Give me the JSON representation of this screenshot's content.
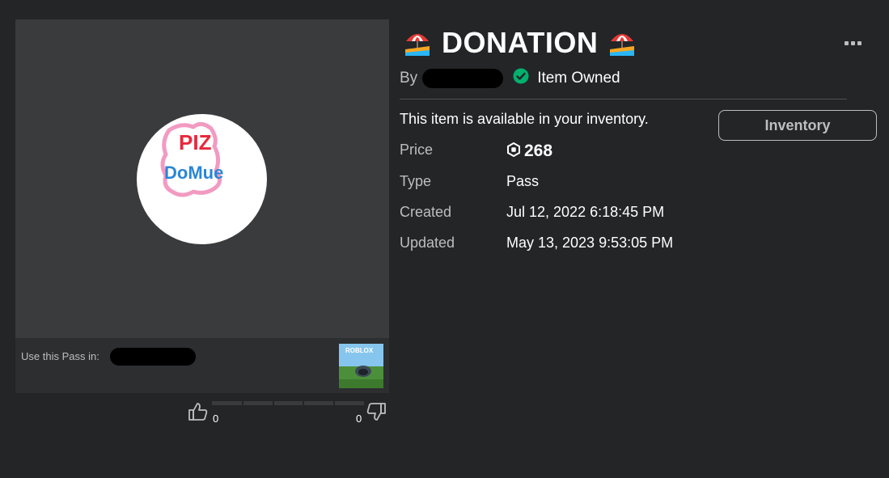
{
  "item": {
    "title": "DONATION",
    "title_emoji_left": "beach-umbrella",
    "title_emoji_right": "beach-umbrella",
    "by_label": "By",
    "owned_text": "Item Owned",
    "availability_text": "This item is available in your inventory.",
    "inventory_button": "Inventory",
    "thumbnail_text": [
      "PIZ",
      "DoMue"
    ]
  },
  "details": [
    {
      "key": "Price",
      "value": "268",
      "icon": "robux-icon"
    },
    {
      "key": "Type",
      "value": "Pass"
    },
    {
      "key": "Created",
      "value": "Jul 12, 2022 6:18:45 PM"
    },
    {
      "key": "Updated",
      "value": "May 13, 2023 9:53:05 PM"
    }
  ],
  "use_in": {
    "label": "Use this Pass in:",
    "game_thumb_label": "ROBLOX"
  },
  "votes": {
    "up": "0",
    "down": "0"
  },
  "colors": {
    "background": "#232527",
    "panel": "#393b3d",
    "owned_check": "#00b06f",
    "muted_text": "#bdbebe"
  }
}
